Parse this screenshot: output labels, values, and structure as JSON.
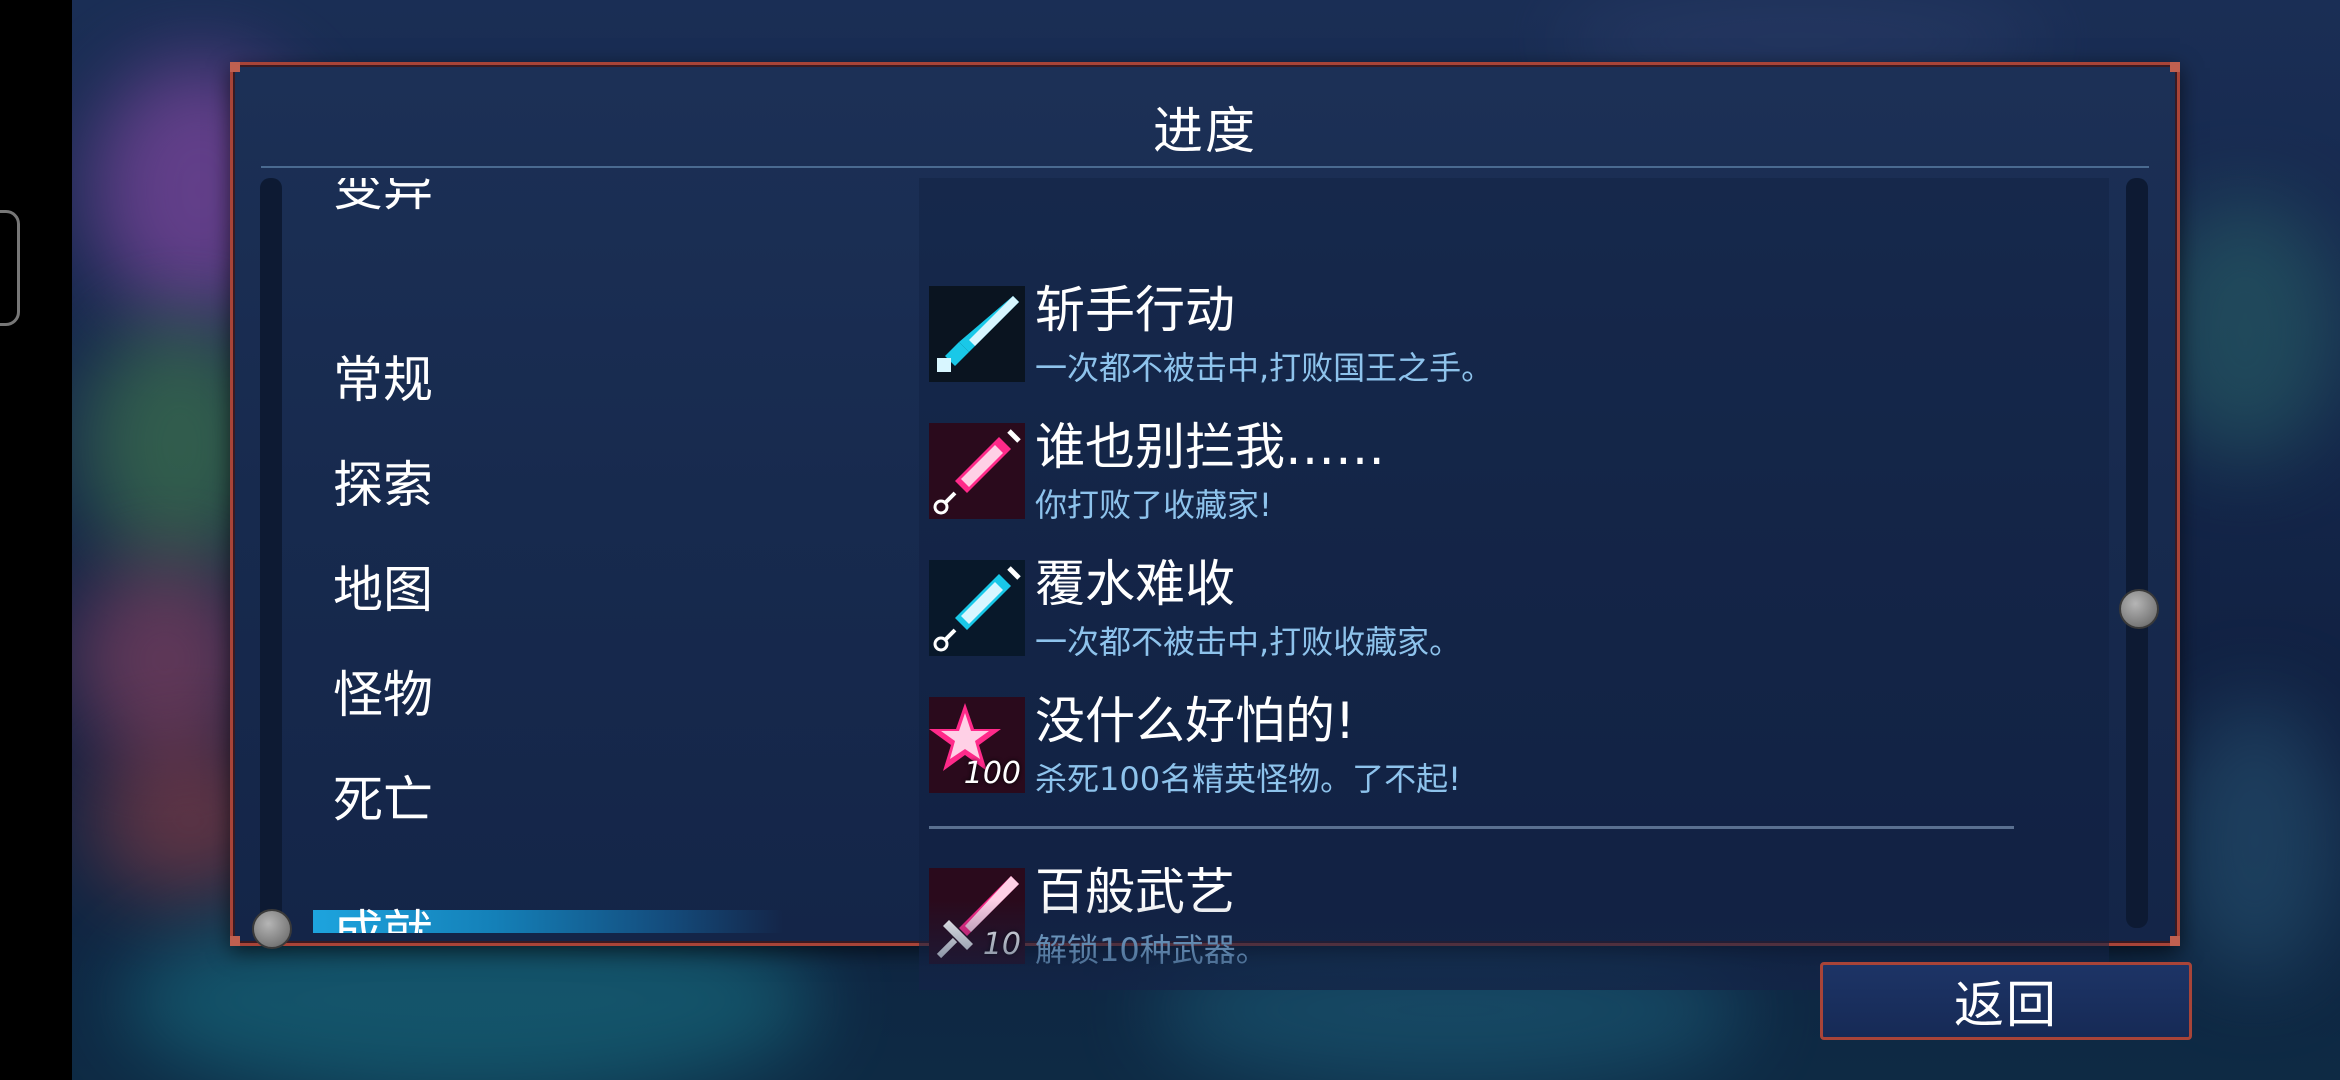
{
  "panel": {
    "title": "进度"
  },
  "categories": [
    {
      "label": "变异",
      "selected": false
    },
    {
      "label": "常规",
      "selected": false
    },
    {
      "label": "探索",
      "selected": false
    },
    {
      "label": "地图",
      "selected": false
    },
    {
      "label": "怪物",
      "selected": false
    },
    {
      "label": "死亡",
      "selected": false
    },
    {
      "label": "成就",
      "selected": true
    }
  ],
  "achievements": [
    {
      "title": "斩手行动",
      "desc": "一次都不被击中,打败国王之手。",
      "icon": "sword-blade-icon",
      "icon_color": "#19c8e8",
      "badge": ""
    },
    {
      "title": "谁也别拦我……",
      "desc": "你打败了收藏家!",
      "icon": "syringe-icon",
      "icon_color": "#ff2a8a",
      "badge": ""
    },
    {
      "title": "覆水难收",
      "desc": "一次都不被击中,打败收藏家。",
      "icon": "syringe-icon",
      "icon_color": "#19c8e8",
      "badge": ""
    },
    {
      "title": "没什么好怕的!",
      "desc": "杀死100名精英怪物。了不起!",
      "icon": "star-icon",
      "icon_color": "#ff2a8a",
      "badge": "100"
    },
    {
      "title": "百般武艺",
      "desc": "解锁10种武器。",
      "icon": "sword-icon",
      "icon_color": "#ff2a8a",
      "badge": "10"
    }
  ],
  "back_button": {
    "label": "返回"
  },
  "colors": {
    "accent_border": "#a84438",
    "selected_tab": "#1ea6e0",
    "desc_text": "#8ec3ec"
  }
}
